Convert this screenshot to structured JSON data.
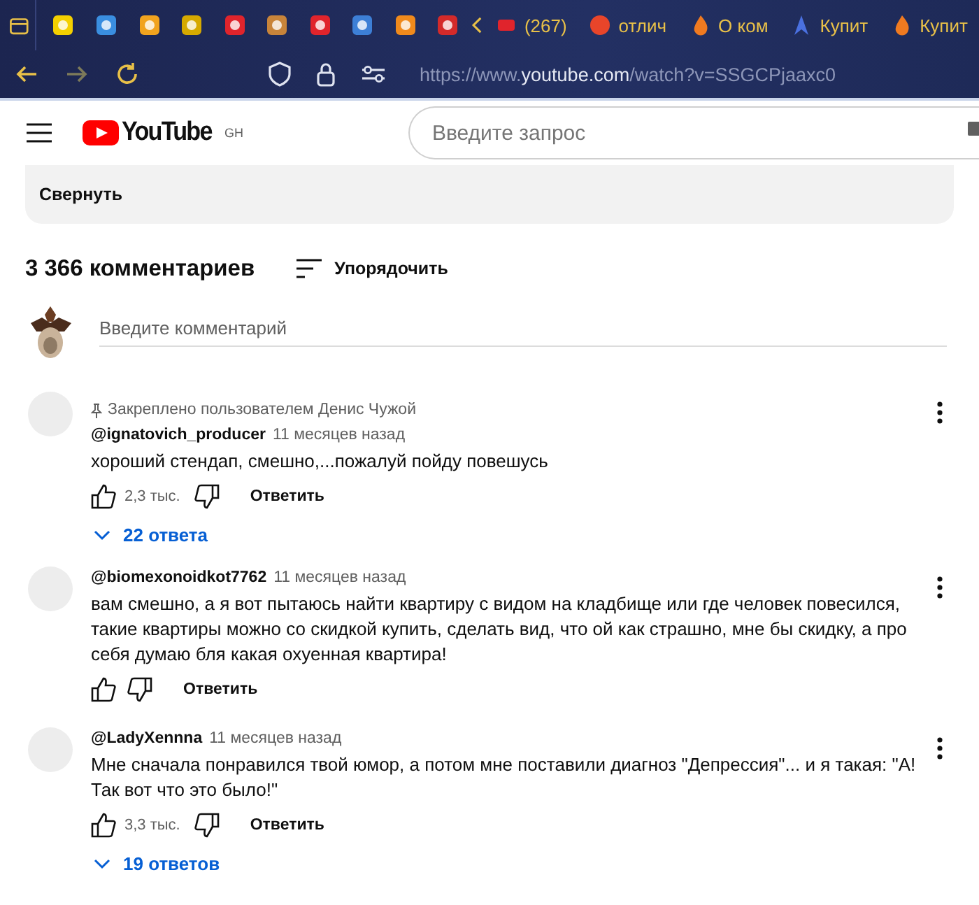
{
  "browser": {
    "tabs": [
      {
        "label": "(267)"
      },
      {
        "label": "отлич"
      },
      {
        "label": "О ком"
      },
      {
        "label": "Купит"
      },
      {
        "label": "Купит"
      }
    ],
    "address_bar": {
      "url": "https://www.**youtube.com**/watch?v=SSGCPjaaxc0"
    }
  },
  "masthead": {
    "logo": "YouTube",
    "region": "GH",
    "search": {
      "placeholder": "Введите запрос"
    }
  },
  "description": {
    "collapse_button": "Свернуть"
  },
  "comments": {
    "count": "3 366 комментариев",
    "sort_button": "Упорядочить",
    "input": {
      "placeholder": "Введите комментарий"
    },
    "items": [
      {
        "pinned": "Закреплено пользователем Денис Чужой",
        "author": "@ignatovich_producer",
        "time": "11 месяцев назад",
        "text": "хороший стендап, смешно,...пожалуй пойду повешусь",
        "likes": "2,3 тыс.",
        "reply_button": "Ответить",
        "replies": "22 ответа"
      },
      {
        "author": "@biomexonoidkot7762",
        "time": "11 месяцев назад",
        "text": "вам смешно, а я вот пытаюсь найти квартиру с видом на кладбище или где человек повесился, такие квартиры можно со скидкой купить, сделать вид, что ой как страшно, мне бы скидку, а про себя думаю бля какая охуенная квартира!",
        "reply_button": "Ответить"
      },
      {
        "author": "@LadyXennna",
        "time": "11 месяцев назад",
        "text": "Мне сначала понравился твой юмор, а потом мне поставили диагноз \"Депрессия\"... и я такая: \"А! Так вот что это было!\"",
        "likes": "3,3 тыс.",
        "reply_button": "Ответить",
        "replies": "19 ответов"
      }
    ]
  }
}
